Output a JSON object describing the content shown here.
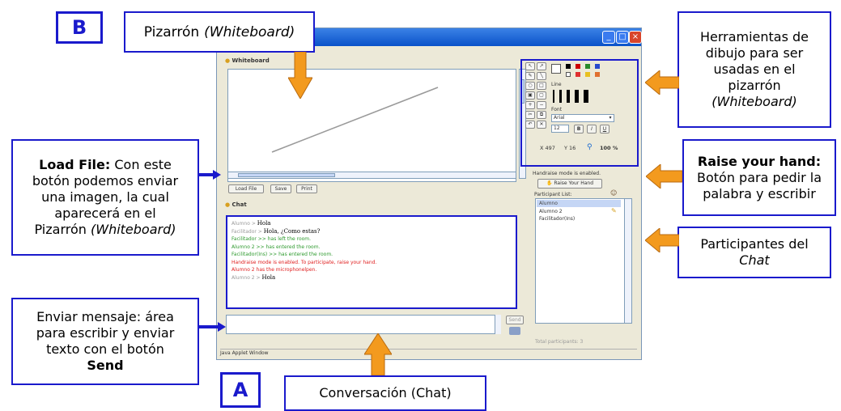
{
  "labels": {
    "a": "A",
    "b": "B"
  },
  "callouts": {
    "whiteboard_title": "Pizarrón",
    "whiteboard_title_italic": "(Whiteboard)",
    "tools_line1": "Herramientas de",
    "tools_line2": "dibujo para ser",
    "tools_line3": "usadas en el",
    "tools_line4": "pizarrón",
    "tools_line5": "(Whiteboard)",
    "loadfile_bold": "Load File:",
    "loadfile_line1": "Con este",
    "loadfile_line2": "botón podemos enviar",
    "loadfile_line3": "una imagen, la cual",
    "loadfile_line4": "aparecerá en el",
    "loadfile_line5": "Pizarrón",
    "loadfile_line5_italic": "(Whiteboard)",
    "raise_bold": "Raise your hand:",
    "raise_line1": "Botón para pedir la",
    "raise_line2": "palabra y escribir",
    "participants_line1": "Participantes del",
    "participants_line2": "Chat",
    "send_line1": "Enviar mensaje: área",
    "send_line2": "para escribir y enviar",
    "send_line3": "texto con el botón",
    "send_bold": "Send",
    "chat_title": "Conversación (Chat)"
  },
  "window": {
    "whiteboard_label": "Whiteboard",
    "load_file": "Load File",
    "save": "Save",
    "print": "Print",
    "chat_label": "Chat",
    "line_label": "Line",
    "font_label": "Font",
    "font_value": "Arial",
    "font_size": "12",
    "coord_x": "X 497",
    "coord_y": "Y 16",
    "zoom": "100 %",
    "handraise_status": "Handraise mode is enabled.",
    "raise_hand_button": "Raise Your Hand",
    "participant_list_label": "Participant List:",
    "participants": [
      "Alumno",
      "Alumno 2",
      "Facilitador(Ins)"
    ],
    "total_participants": "Total participants: 3",
    "send_button": "Send",
    "status_bar": "Java Applet Window"
  },
  "chat_messages": [
    {
      "sender": "Alumno",
      "text": "Hola",
      "color": "#999999"
    },
    {
      "sender": "Facilitador",
      "text": "Hola, ¿Como estas?",
      "color": "#999999"
    },
    {
      "sender": "",
      "text": "Facilitador >> has left the room.",
      "color": "#2e9a2e"
    },
    {
      "sender": "",
      "text": "Alumno 2 >> has entered the room.",
      "color": "#2e9a2e"
    },
    {
      "sender": "",
      "text": "Facilitador(Ins) >> has entered the room.",
      "color": "#2e9a2e"
    },
    {
      "sender": "",
      "text": "Handraise mode is enabled. To participate, raise your hand.",
      "color": "#e02020"
    },
    {
      "sender": "",
      "text": "Alumno 2 has the microphonelpen.",
      "color": "#e02020"
    },
    {
      "sender": "Alumno 2",
      "text": "Hola",
      "color": "#999999"
    }
  ],
  "colors": {
    "callout_border": "#1a1acc",
    "arrow": "#f39a1e",
    "window_bg": "#ece9d8",
    "titlebar": "#0a52c9"
  }
}
